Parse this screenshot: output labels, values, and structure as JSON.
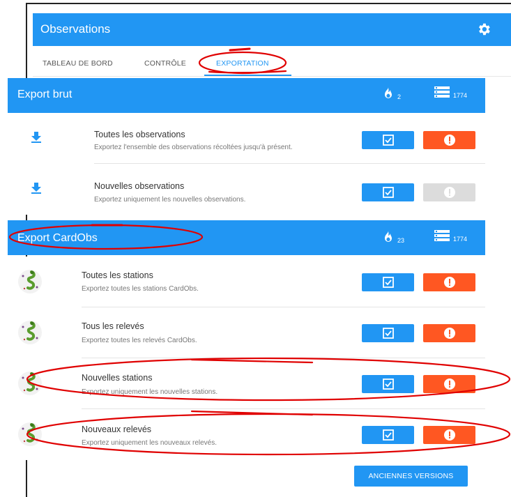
{
  "header": {
    "title": "Observations",
    "settings_icon": "gear-icon"
  },
  "tabs": [
    {
      "label": "TABLEAU DE BORD",
      "active": false
    },
    {
      "label": "CONTRÔLE",
      "active": false
    },
    {
      "label": "EXPORTATION",
      "active": true
    }
  ],
  "sections": [
    {
      "title": "Export brut",
      "stats": [
        {
          "icon": "fire-icon",
          "value": "2"
        },
        {
          "icon": "list-icon",
          "value": "1774"
        }
      ],
      "rows": [
        {
          "title": "Toutes les observations",
          "desc": "Exportez l'ensemble des observations récoltées jusqu'à présent.",
          "icon": "download-icon",
          "warn_enabled": true
        },
        {
          "title": "Nouvelles observations",
          "desc": "Exportez uniquement les nouvelles observations.",
          "icon": "download-icon",
          "warn_enabled": false
        }
      ]
    },
    {
      "title": "Export CardObs",
      "stats": [
        {
          "icon": "fire-icon",
          "value": "23"
        },
        {
          "icon": "list-icon",
          "value": "1774"
        }
      ],
      "rows": [
        {
          "title": "Toutes les stations",
          "desc": "Exportez toutes les stations CardObs.",
          "icon": "gecko-icon",
          "warn_enabled": true
        },
        {
          "title": "Tous les relevés",
          "desc": "Exportez toutes les relevés CardObs.",
          "icon": "gecko-icon",
          "warn_enabled": true
        },
        {
          "title": "Nouvelles stations",
          "desc": "Exportez uniquement les nouvelles stations.",
          "icon": "gecko-icon",
          "warn_enabled": true
        },
        {
          "title": "Nouveaux relevés",
          "desc": "Exportez uniquement les nouveaux relevés.",
          "icon": "gecko-icon",
          "warn_enabled": true
        }
      ]
    }
  ],
  "footer": {
    "old_versions_label": "ANCIENNES VERSIONS"
  },
  "colors": {
    "primary": "#2196F3",
    "warning": "#FF5722",
    "disabled": "#dcdcdc",
    "annotation": "#e00000"
  }
}
